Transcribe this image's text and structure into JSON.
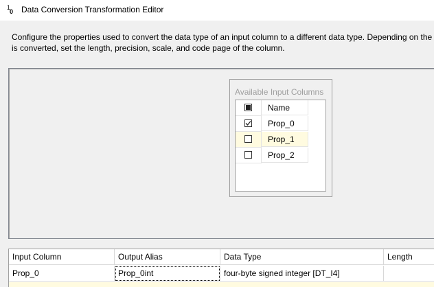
{
  "window": {
    "title": "Data Conversion Transformation Editor",
    "icon": "data-conversion-icon",
    "icon_glyph_top": "1",
    "icon_glyph_bottom": "0"
  },
  "description": {
    "line1": "Configure the properties used to convert the data type of an input column to a different data type. Depending on the",
    "line2": "is converted, set the length, precision, scale, and code page of the column."
  },
  "available_columns": {
    "title": "Available Input Columns",
    "header_name": "Name",
    "rows": [
      {
        "name": "Prop_0",
        "checked": true
      },
      {
        "name": "Prop_1",
        "checked": false
      },
      {
        "name": "Prop_2",
        "checked": false
      }
    ]
  },
  "conversion_grid": {
    "headers": [
      "Input Column",
      "Output Alias",
      "Data Type",
      "Length"
    ],
    "rows": [
      {
        "input_column": "Prop_0",
        "output_alias": "Prop_0int",
        "data_type": "four-byte signed integer [DT_I4]",
        "length": ""
      }
    ]
  },
  "colors": {
    "background": "#f0f0f0",
    "grid_background": "#ffffff",
    "row_highlight": "#fffbe0",
    "disabled_text": "#a0a0a0"
  }
}
